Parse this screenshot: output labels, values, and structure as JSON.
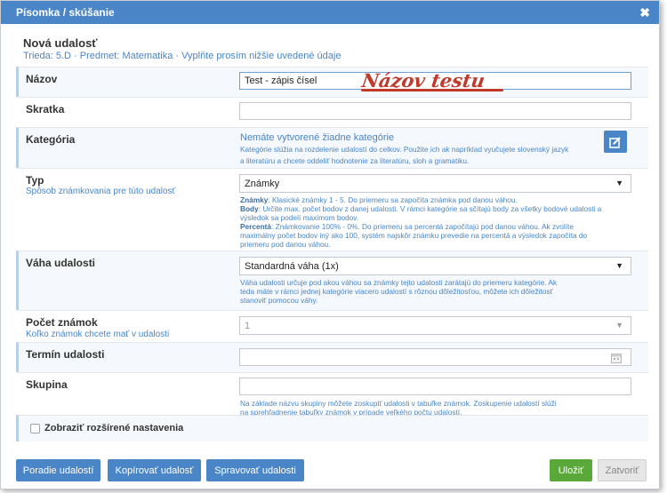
{
  "dialog": {
    "title": "Písomka / skúšanie",
    "close_symbol": "✖",
    "heading": "Nová udalosť",
    "subheading": "Trieda: 5.D · Predmet: Matematika · Vyplňte prosím nižšie uvedené údaje"
  },
  "fields": {
    "nazov": {
      "label": "Názov",
      "value": "Test - zápis čísel",
      "annotation": "Názov testu"
    },
    "skratka": {
      "label": "Skratka",
      "value": ""
    },
    "kategoria": {
      "label": "Kategória",
      "message": "Nemáte vytvorené žiadne kategórie",
      "help_line1": "Kategórie slúžia na rozdelenie udalostí do celkov. Použite ich ak napríklad vyučujete slovenský jazyk",
      "help_line2": "a literatúru a chcete oddeliť hodnotenie za literatúru, sloh a gramatiku.",
      "edit_icon": "edit-icon"
    },
    "typ": {
      "label": "Typ",
      "sublabel": "Spôsob známkovania pre túto udalosť",
      "selected": "Známky",
      "help": [
        {
          "bold": "Známky",
          "text": ": Klasické známky 1 - 5. Do priemeru sa započíta známka pod danou váhou."
        },
        {
          "bold": "Body",
          "text": ": Určíte max. počet bodov z danej udalosti. V rámci kategórie sa sčítajú body za všetky bodové udalosti a"
        },
        {
          "bold": "",
          "text": "výsledok sa podelí maximom bodov."
        },
        {
          "bold": "Percentá",
          "text": ": Známkovanie 100% - 0%. Do priemeru sa percentá započítajú pod danou váhou. Ak zvolíte"
        },
        {
          "bold": "",
          "text": "maximálny počet bodov iný ako 100, systém najskôr známku prevedie na percentá a výsledok započíta do"
        },
        {
          "bold": "",
          "text": "priemeru pod danou váhou."
        }
      ]
    },
    "vaha": {
      "label": "Váha udalosti",
      "selected": "Standardná váha (1x)",
      "help_line1": "Váha udalosti určuje pod akou váhou sa známky tejto udalosti zarátajú do priemeru kategórie. Ak",
      "help_line2": "teda máte v rámci jednej kategórie viacero udalostí s rôznou dôležitosťou, môžete ich dôležitosť",
      "help_line3": "stanoviť pomocou váhy."
    },
    "pocet": {
      "label": "Počet známok",
      "sublabel": "Koľko známok chcete mať v udalosti",
      "selected": "1"
    },
    "termin": {
      "label": "Termín udalosti",
      "value": "",
      "calendar_icon": "calendar-icon"
    },
    "skupina": {
      "label": "Skupina",
      "value": "",
      "help_line1": "Na základe názvu skupiny môžete zoskupiť udalosti v tabuľke známok. Zoskupenie udalostí slúži",
      "help_line2": "na sprehľadnenie tabuľky známok v prípade veľkého počtu udalostí."
    },
    "advanced": {
      "label": "Zobraziť rozšírené nastavenia",
      "checked": false
    }
  },
  "footer": {
    "poradie": "Poradie udalostí",
    "kopirovat": "Kopírovať udalosť",
    "spravovat": "Spravovať udalosti",
    "ulozit": "Uložiť",
    "zatvorit": "Zatvoriť"
  },
  "colors": {
    "primary": "#4a86c7",
    "success": "#5aa83a",
    "annotation": "#c0392b"
  }
}
